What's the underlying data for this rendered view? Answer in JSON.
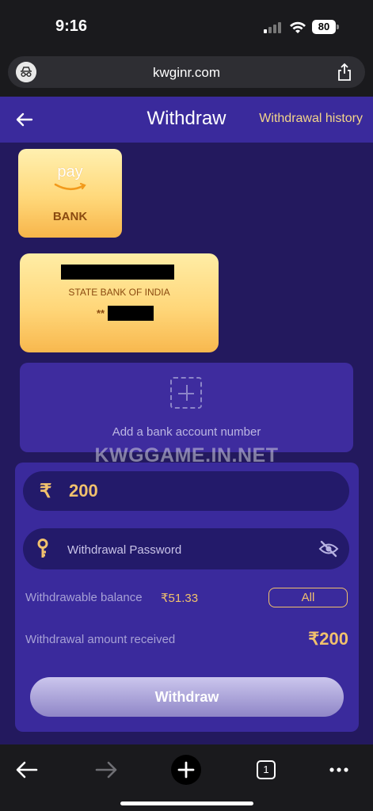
{
  "status_bar": {
    "time": "9:16",
    "battery": "80"
  },
  "browser": {
    "url": "kwginr.com"
  },
  "header": {
    "title": "Withdraw",
    "history_link": "Withdrawal history"
  },
  "payment_methods": [
    {
      "logo_text": "pay",
      "label": "BANK"
    }
  ],
  "bank_card": {
    "bank_name": "STATE BANK OF INDIA",
    "masked_account": "**"
  },
  "add_bank": {
    "label": "Add a bank account number"
  },
  "watermark": "KWGGAME.IN.NET",
  "form": {
    "currency_symbol": "₹",
    "amount_value": "200",
    "password_placeholder": "Withdrawal Password",
    "balance_label": "Withdrawable balance",
    "balance_value": "₹51.33",
    "all_button": "All",
    "received_label": "Withdrawal amount received",
    "received_value": "₹200",
    "submit_label": "Withdraw"
  },
  "bottom_toolbar": {
    "tab_count": "1"
  },
  "colors": {
    "accent_gold": "#f1c16d",
    "header_purple": "#3a2a9c",
    "background": "#23195e"
  }
}
